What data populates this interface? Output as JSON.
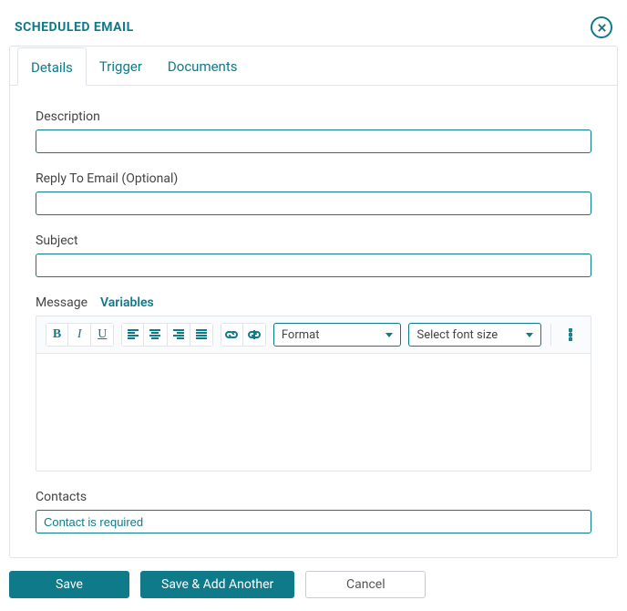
{
  "title": "SCHEDULED EMAIL",
  "tabs": {
    "details": "Details",
    "trigger": "Trigger",
    "documents": "Documents",
    "active": "details"
  },
  "fields": {
    "description_label": "Description",
    "description_value": "",
    "reply_to_label": "Reply To Email (Optional)",
    "reply_to_value": "",
    "subject_label": "Subject",
    "subject_value": "",
    "message_label": "Message",
    "variables_label": "Variables",
    "contacts_label": "Contacts",
    "contacts_placeholder": "Contact is required"
  },
  "toolbar": {
    "bold": "B",
    "italic": "I",
    "underline": "U",
    "format_label": "Format",
    "fontsize_label": "Select font size"
  },
  "footer": {
    "save": "Save",
    "save_add": "Save & Add Another",
    "cancel": "Cancel"
  }
}
